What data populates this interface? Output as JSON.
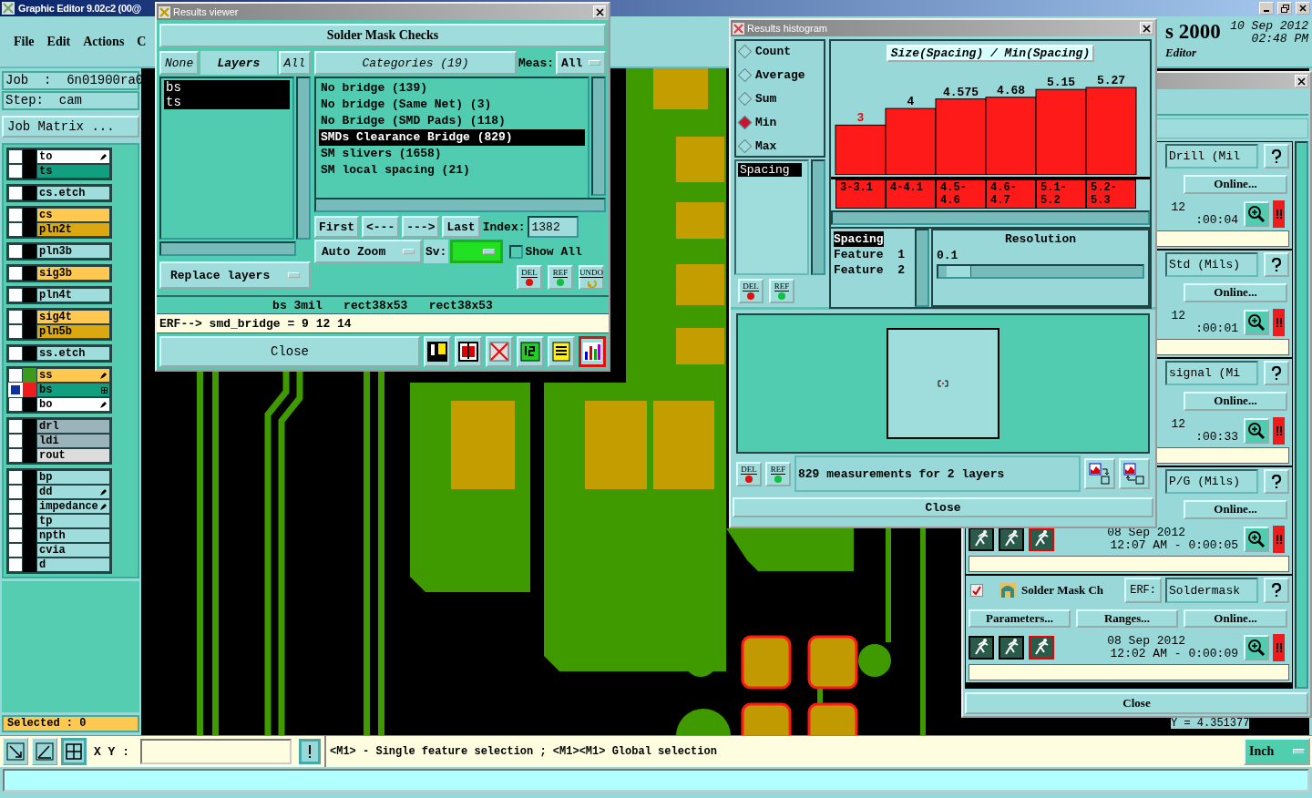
{
  "app": {
    "title": "Graphic Editor 9.02c2 (00@",
    "menu": [
      "File",
      "Edit",
      "Actions",
      "C"
    ],
    "header": {
      "product": "s 2000",
      "date": "10 Sep 2012",
      "time": "02:48 PM",
      "subtitle": "Editor"
    }
  },
  "job": {
    "job": "Job  :  6n01900ra0",
    "step": "Step:  cam",
    "matrix_button": "Job Matrix ..."
  },
  "layer_groups": [
    [
      {
        "name": "to",
        "color": "#ffffff",
        "marker": {
          "kind": "pen"
        },
        "affected": false
      },
      {
        "name": "ts",
        "color": "#10a080",
        "affected": false
      }
    ],
    [
      {
        "name": "cs.etch",
        "color": "#9fdcdc",
        "affected": false
      }
    ],
    [
      {
        "name": "cs",
        "color": "#ffc850",
        "affected": false
      },
      {
        "name": "pln2t",
        "color": "#dca810",
        "affected": false
      }
    ],
    [
      {
        "name": "pln3b",
        "color": "#9fdcdc",
        "affected": false
      }
    ],
    [
      {
        "name": "sig3b",
        "color": "#ffc850",
        "affected": false
      }
    ],
    [
      {
        "name": "pln4t",
        "color": "#9fdcdc",
        "affected": false
      }
    ],
    [
      {
        "name": "sig4t",
        "color": "#ffc850",
        "affected": false
      },
      {
        "name": "pln5b",
        "color": "#dca810",
        "affected": false
      }
    ],
    [
      {
        "name": "ss.etch",
        "color": "#9fdcdc",
        "affected": false
      }
    ],
    [
      {
        "name": "ss",
        "color": "#ffc850",
        "swatch": {
          "color": "#3c9a1c"
        },
        "marker": {
          "kind": "pen"
        },
        "affected": false
      },
      {
        "name": "bs",
        "color": "#10a080",
        "swatch": {
          "color": "#ee1c1c"
        },
        "marker": {
          "kind": "grid"
        },
        "affected": true
      },
      {
        "name": "bo",
        "color": "#ffffff",
        "marker": {
          "kind": "pen"
        },
        "affected": false
      }
    ],
    [
      {
        "name": "drl",
        "color": "#9bb4bc",
        "affected": false
      },
      {
        "name": "ldi",
        "color": "#9bb4bc",
        "affected": false
      },
      {
        "name": "rout",
        "color": "#dcdcdc",
        "affected": false
      }
    ],
    [
      {
        "name": "bp",
        "color": "#9fdcdc",
        "affected": false
      },
      {
        "name": "dd",
        "color": "#9fdcdc",
        "marker": {
          "kind": "pen"
        },
        "affected": false
      },
      {
        "name": "impedance",
        "color": "#9fdcdc",
        "marker": {
          "kind": "pen"
        },
        "affected": false
      },
      {
        "name": "tp",
        "color": "#9fdcdc",
        "affected": false
      },
      {
        "name": "npth",
        "color": "#9fdcdc",
        "affected": false
      },
      {
        "name": "cvia",
        "color": "#9fdcdc",
        "affected": false
      },
      {
        "name": "d",
        "color": "#9fdcdc",
        "affected": false
      }
    ]
  ],
  "selected_count": "Selected : 0",
  "results_viewer": {
    "title": "Results viewer",
    "heading": "Solder Mask Checks",
    "layer_buttons": [
      {
        "label": "None",
        "kind": "button"
      },
      {
        "label": "Layers",
        "kind": "header"
      },
      {
        "label": "All",
        "kind": "button"
      }
    ],
    "layers": [
      {
        "name": "bs",
        "selected": true
      },
      {
        "name": "ts",
        "selected": true
      }
    ],
    "categories_button": "Categories (19)",
    "meas_label": "Meas:",
    "meas_value": "All",
    "categories": [
      {
        "label": "No bridge (139)",
        "selected": false
      },
      {
        "label": "No bridge (Same Net) (3)",
        "selected": false
      },
      {
        "label": "No Bridge (SMD Pads) (118)",
        "selected": false
      },
      {
        "label": "SMDs Clearance Bridge (829)",
        "selected": true
      },
      {
        "label": "SM slivers (1658)",
        "selected": false
      },
      {
        "label": "SM local spacing (21)",
        "selected": false
      }
    ],
    "nav": [
      "First",
      "<---",
      "--->",
      "Last"
    ],
    "index_label": "Index:",
    "index_value": "1382",
    "zoom_mode": "Auto Zoom",
    "sv": {
      "label": "Sv:",
      "color": "#22e022"
    },
    "show_all": {
      "label": "Show All",
      "checked": false
    },
    "replace_mode": "Replace layers",
    "edit_buttons": [
      {
        "label": "DEL",
        "kind": "dot",
        "color": "#e01010"
      },
      {
        "label": "REF",
        "kind": "dot",
        "color": "#10c040"
      },
      {
        "label": "UNDO",
        "kind": "undo"
      }
    ],
    "info": "bs 3mil   rect38x53   rect38x53",
    "erf": "ERF--> smd_bridge = 9 12 14",
    "close": "Close",
    "tools": [
      {
        "kind": "figure",
        "selected": false
      },
      {
        "kind": "layer",
        "selected": false
      },
      {
        "kind": "crossed",
        "selected": false
      },
      {
        "kind": "page",
        "selected": false
      },
      {
        "kind": "report",
        "selected": false
      },
      {
        "kind": "histogram",
        "selected": true
      }
    ]
  },
  "histogram": {
    "title": "Results histogram",
    "modes": [
      {
        "label": "Count",
        "selected": false
      },
      {
        "label": "Average",
        "selected": false
      },
      {
        "label": "Sum",
        "selected": false
      },
      {
        "label": "Min",
        "selected": true
      },
      {
        "label": "Max",
        "selected": false
      }
    ],
    "fields": [
      {
        "label": "Spacing",
        "selected": true
      }
    ],
    "edit_buttons": [
      {
        "label": "DEL",
        "color": "#e01010"
      },
      {
        "label": "REF",
        "color": "#10c040"
      }
    ],
    "chart_data": {
      "type": "bar",
      "title": "Size(Spacing) / Min(Spacing)",
      "categories": [
        "3-3.1",
        "4-4.1",
        "4.5-4.6",
        "4.6-4.7",
        "5.1-5.2",
        "5.2-5.3"
      ],
      "values": [
        3,
        4,
        4.575,
        4.68,
        5.15,
        5.27
      ],
      "value_labels": [
        "3",
        "4",
        "4.575",
        "4.68",
        "5.15",
        "5.27"
      ]
    },
    "columns": [
      {
        "label": "Spacing",
        "selected": true
      },
      {
        "label": "Feature  1",
        "selected": false
      },
      {
        "label": "Feature  2",
        "selected": false
      }
    ],
    "resolution": {
      "label": "Resolution",
      "value": "0.1",
      "level": 0.04
    },
    "bottom_buttons": [
      {
        "label": "DEL",
        "color": "#e01010"
      },
      {
        "label": "REF",
        "color": "#10c040"
      }
    ],
    "summary": "829 measurements for 2 layers",
    "close": "Close"
  },
  "checks_window": {
    "entries": [
      {
        "field": "Drill (Mil",
        "buttons": [
          "Online..."
        ],
        "date": "12",
        "time": ":00:04"
      },
      {
        "field": "Std (Mils)",
        "buttons": [
          "Online..."
        ],
        "date": "12",
        "time": ":00:01"
      },
      {
        "field": "signal (Mi",
        "buttons": [
          "Online..."
        ],
        "date": "12",
        "time": ":00:33"
      },
      {
        "field": "P/G (Mils)",
        "buttons": [
          "Online..."
        ],
        "date": "08 Sep 2012",
        "time": "12:07 AM - 0:00:05",
        "run_icons": true
      },
      {
        "checked": true,
        "title": "Solder Mask Ch",
        "erf": "ERF:",
        "field": "Soldermask",
        "buttons": [
          "Parameters...",
          "Ranges...",
          "Online..."
        ],
        "date": "08 Sep 2012",
        "time": "12:02 AM - 0:00:09",
        "run_icons": true
      }
    ],
    "close": "Close",
    "y_reading": "Y = 4.351377"
  },
  "bottom_bar": {
    "tools": [
      {
        "kind": "zoom-box",
        "selected": false
      },
      {
        "kind": "measure",
        "selected": false
      },
      {
        "kind": "grid",
        "selected": true
      }
    ],
    "xy_label": "X Y :",
    "status": "<M1> - Single feature selection ; <M1><M1> Global selection",
    "units": "Inch"
  }
}
